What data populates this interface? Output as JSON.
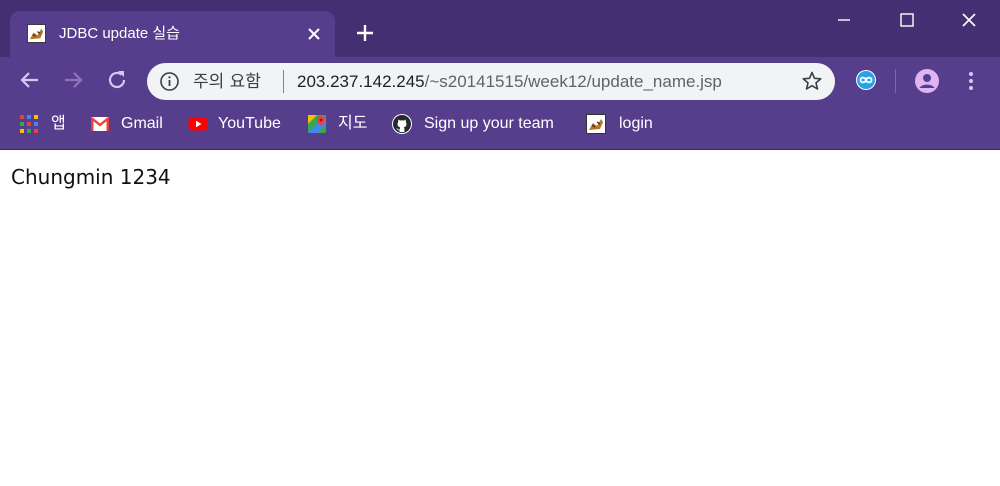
{
  "browser": {
    "tab": {
      "title": "JDBC update 실습",
      "favicon": "tiger-logo-icon",
      "close_icon": "close-icon"
    },
    "new_tab_icon": "plus-icon",
    "window_controls": [
      "minimize-icon",
      "maximize-icon",
      "close-icon"
    ],
    "nav": {
      "back_icon": "back-arrow-icon",
      "forward_icon": "forward-arrow-icon",
      "reload_icon": "reload-icon"
    },
    "omnibox": {
      "security_text": "주의 요함",
      "url_host": "203.237.142.245",
      "url_path": "/~s20141515/week12/update_name.jsp"
    },
    "bookmarks": [
      {
        "label": "앱",
        "icon": "apps-grid-icon"
      },
      {
        "label": "Gmail",
        "icon": "gmail-icon"
      },
      {
        "label": "YouTube",
        "icon": "youtube-icon"
      },
      {
        "label": "지도",
        "icon": "maps-icon"
      },
      {
        "label": "Sign up your team",
        "icon": "github-icon"
      },
      {
        "label": "login",
        "icon": "tiger-logo-icon"
      }
    ],
    "colors": {
      "tabstrip": "#442f72",
      "toolbar": "#573e8c",
      "omnibox": "#f1f3f4"
    }
  },
  "page": {
    "text": "Chungmin 1234"
  }
}
